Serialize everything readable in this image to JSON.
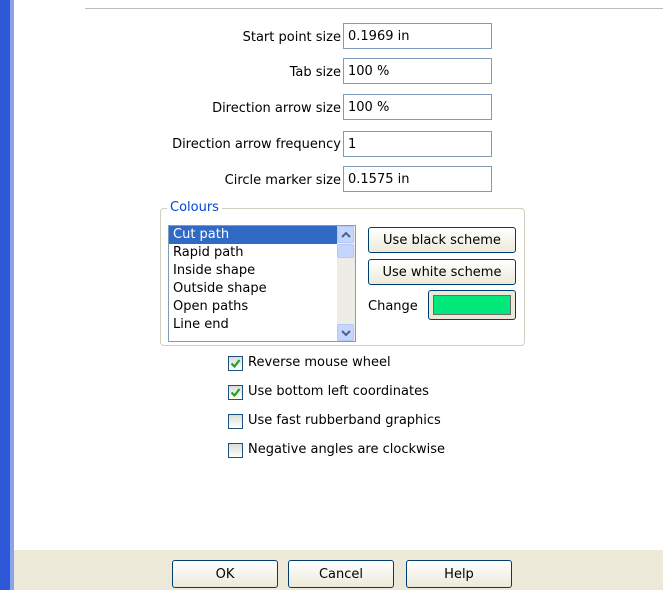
{
  "fields": [
    {
      "label": "Start point size",
      "value": "0.1969 in"
    },
    {
      "label": "Tab size",
      "value": "100 %"
    },
    {
      "label": "Direction arrow size",
      "value": "100 %"
    },
    {
      "label": "Direction arrow frequency",
      "value": "1"
    },
    {
      "label": "Circle marker size",
      "value": "0.1575 in"
    }
  ],
  "colours": {
    "title": "Colours",
    "items": [
      "Cut path",
      "Rapid path",
      "Inside shape",
      "Outside shape",
      "Open paths",
      "Line end"
    ],
    "selected": "Cut path",
    "black_scheme_label": "Use black scheme",
    "white_scheme_label": "Use white scheme",
    "change_label": "Change",
    "current_color": "#00e87a"
  },
  "options": [
    {
      "label": "Reverse mouse wheel",
      "checked": true
    },
    {
      "label": "Use bottom left coordinates",
      "checked": true
    },
    {
      "label": "Use fast rubberband graphics",
      "checked": false
    },
    {
      "label": "Negative angles are clockwise",
      "checked": false
    }
  ],
  "buttons": {
    "ok": "OK",
    "cancel": "Cancel",
    "help": "Help"
  },
  "colors": {
    "accent_border": "#2f58d8",
    "selection": "#316ac5",
    "group_title": "#0046d5"
  }
}
